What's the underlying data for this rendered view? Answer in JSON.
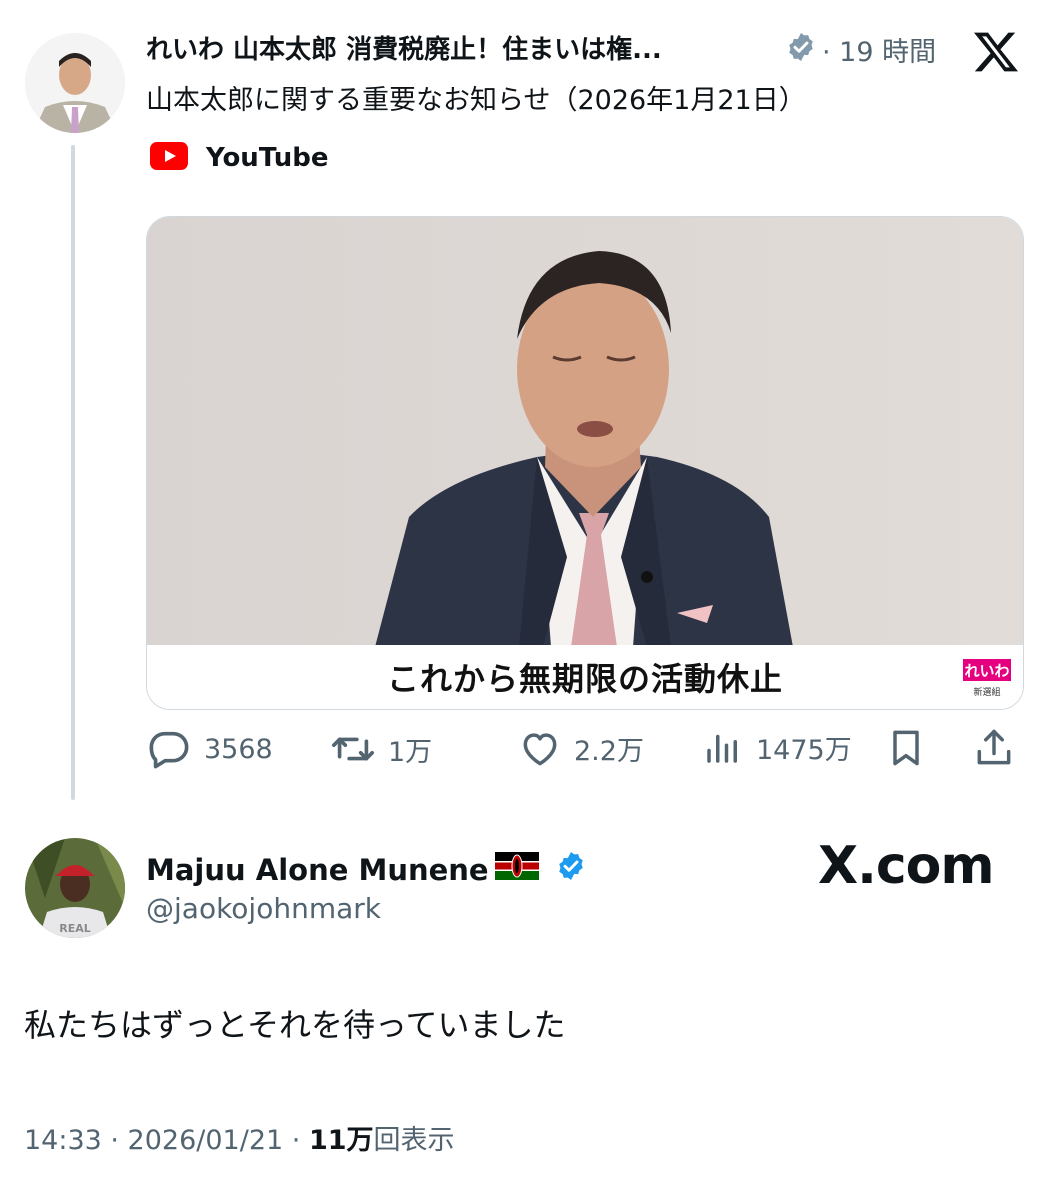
{
  "post": {
    "author_name": "れいわ 山本太郎 消費税廃止！住まいは権...",
    "time_ago": "· 19 時間",
    "text": "山本太郎に関する重要なお知らせ（2026年1月21日）",
    "link_source": "YouTube",
    "video_caption": "これから無期限の活動休止",
    "logo_text": "れいわ",
    "logo_subtext": "新選組",
    "stats": {
      "replies": "3568",
      "reposts": "1万",
      "likes": "2.2万",
      "views": "1475万"
    }
  },
  "reply": {
    "author_name": "Majuu Alone Munene",
    "flag": "🇰🇪",
    "handle": "@jaokojohnmark",
    "text": "私たちはずっとそれを待っていました",
    "timestamp": "14:33 · 2026/01/21 · ",
    "views_count": "11万",
    "views_suffix": "回表示"
  },
  "watermark": "X.com",
  "colors": {
    "verified_gray": "#829aab",
    "verified_blue": "#1d9bf0",
    "youtube_red": "#ff0000",
    "muted_text": "#536471",
    "thread_line": "#cfd9de"
  },
  "icons": [
    "x-logo-icon",
    "verified-badge-icon",
    "youtube-icon",
    "reply-icon",
    "repost-icon",
    "like-icon",
    "views-icon",
    "bookmark-icon",
    "share-icon",
    "kenya-flag-icon"
  ]
}
